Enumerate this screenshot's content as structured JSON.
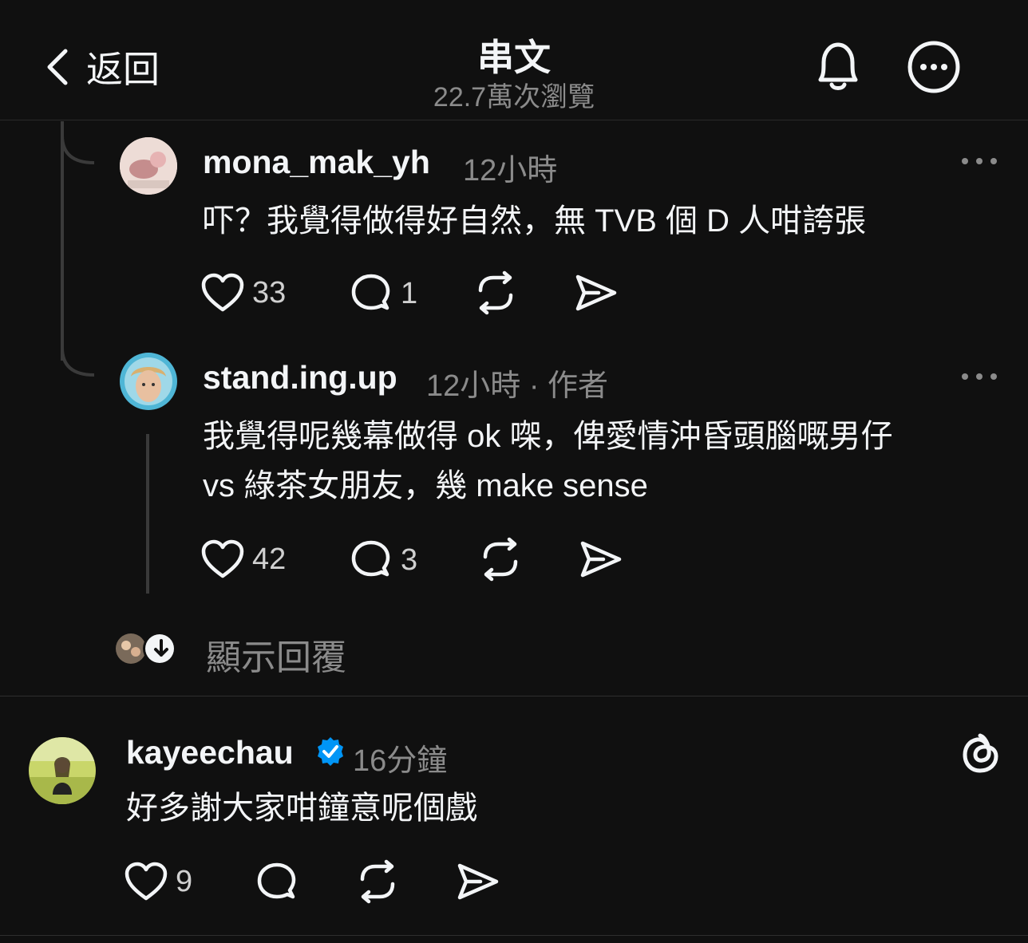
{
  "header": {
    "back_label": "返回",
    "title": "串文",
    "views": "22.7萬次瀏覽"
  },
  "replies": [
    {
      "username": "mona_mak_yh",
      "time": "12小時",
      "text": "吓？我覺得做得好自然，無 TVB 個 D 人咁誇張",
      "likes": "33",
      "comments": "1"
    },
    {
      "username": "stand.ing.up",
      "time": "12小時 · 作者",
      "text_line1": "我覺得呢幾幕做得 ok 㗎，俾愛情沖昏頭腦嘅男仔",
      "text_line2": "vs 綠茶女朋友，幾 make sense",
      "likes": "42",
      "comments": "3"
    }
  ],
  "show_replies_label": "顯示回覆",
  "post": {
    "username": "kayeechau",
    "verified": true,
    "time": "16分鐘",
    "text": "好多謝大家咁鐘意呢個戲",
    "likes": "9"
  },
  "colors": {
    "background": "#101010",
    "text_primary": "#f3f5f7",
    "text_secondary": "#8b8b8b",
    "verified_blue": "#0095f6"
  },
  "icons": [
    "chevron-left-icon",
    "bell-icon",
    "more-circle-icon",
    "heart-icon",
    "comment-icon",
    "repost-icon",
    "share-icon",
    "verified-icon",
    "threads-logo-icon",
    "arrow-down-icon"
  ]
}
